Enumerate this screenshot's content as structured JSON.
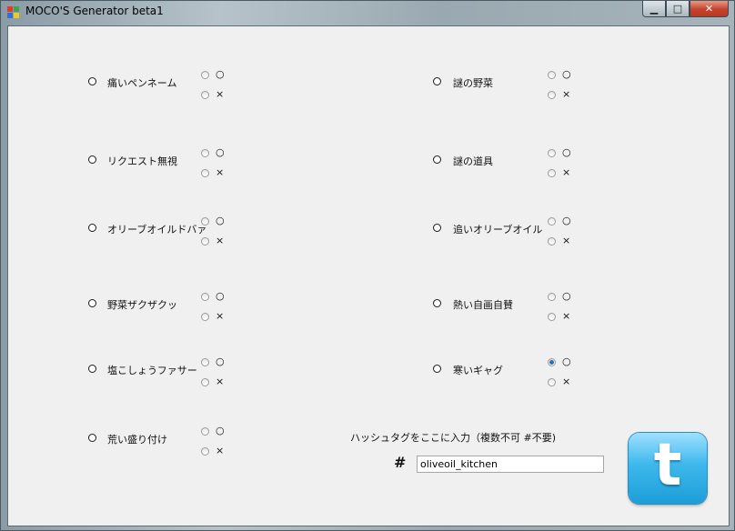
{
  "window": {
    "title": "MOCO'S Generator beta1",
    "min_glyph": "▁",
    "max_glyph": "□",
    "close_glyph": "✕"
  },
  "options": {
    "yes": "○",
    "no": "×"
  },
  "left": [
    {
      "label": "痛いペンネーム",
      "selected": null
    },
    {
      "label": "リクエスト無視",
      "selected": null
    },
    {
      "label": "オリーブオイルドバァ",
      "selected": null
    },
    {
      "label": "野菜ザクザクッ",
      "selected": null
    },
    {
      "label": "塩こしょうファサー",
      "selected": null
    },
    {
      "label": "荒い盛り付け",
      "selected": null
    }
  ],
  "right": [
    {
      "label": "謎の野菜",
      "selected": null
    },
    {
      "label": "謎の道具",
      "selected": null
    },
    {
      "label": "追いオリーブオイル",
      "selected": null
    },
    {
      "label": "熱い自画自賛",
      "selected": null
    },
    {
      "label": "寒いギャグ",
      "selected": "yes"
    }
  ],
  "hashtag": {
    "title": "ハッシュタグをここに入力（複数不可 #不要)",
    "sign": "#",
    "value": "oliveoil_kitchen"
  },
  "twitter": {
    "glyph": "t"
  },
  "colors": {
    "client_bg": "#f0f0f0",
    "twitter_blue": "#3db8ec",
    "radio_checked": "#2f6fb6"
  }
}
